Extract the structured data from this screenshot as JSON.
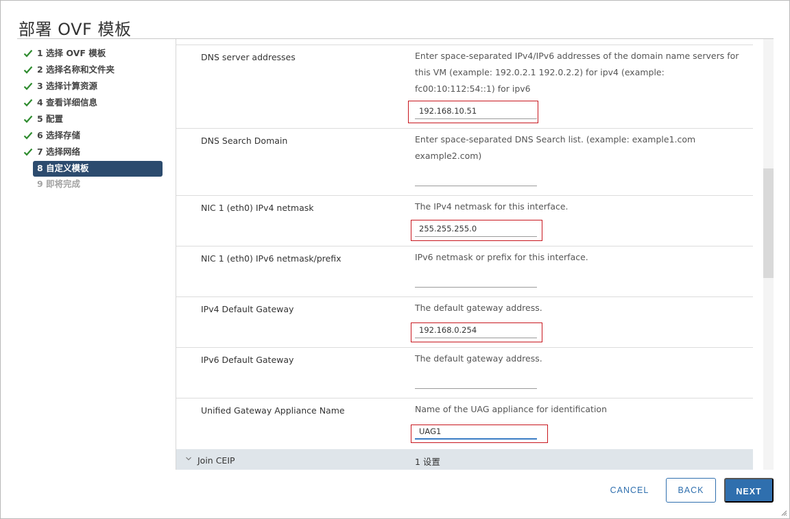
{
  "dialog": {
    "title": "部署 OVF 模板"
  },
  "steps": [
    {
      "label": "1 选择 OVF 模板",
      "status": "done"
    },
    {
      "label": "2 选择名称和文件夹",
      "status": "done"
    },
    {
      "label": "3 选择计算资源",
      "status": "done"
    },
    {
      "label": "4 查看详细信息",
      "status": "done"
    },
    {
      "label": "5 配置",
      "status": "done"
    },
    {
      "label": "6 选择存储",
      "status": "done"
    },
    {
      "label": "7 选择网络",
      "status": "done"
    },
    {
      "label": "8 自定义模板",
      "status": "active"
    },
    {
      "label": "9 即将完成",
      "status": "disabled"
    }
  ],
  "properties": [
    {
      "label": "DNS server addresses",
      "description": "Enter space-separated IPv4/IPv6 addresses of the domain name servers for this VM (example:  192.0.2.1 192.0.2.2) for ipv4 (example: fc00:10:112:54::1) for ipv6",
      "value": "192.168.10.51"
    },
    {
      "label": "DNS Search Domain",
      "description": "Enter space-separated DNS Search list. (example:  example1.com example2.com)",
      "value": ""
    },
    {
      "label": "NIC 1 (eth0) IPv4 netmask",
      "description": "The IPv4 netmask for this interface.",
      "value": "255.255.255.0"
    },
    {
      "label": "NIC 1 (eth0) IPv6 netmask/prefix",
      "description": "IPv6 netmask or prefix for this interface.",
      "value": ""
    },
    {
      "label": "IPv4 Default Gateway",
      "description": "The default gateway address.",
      "value": "192.168.0.254"
    },
    {
      "label": "IPv6 Default Gateway",
      "description": "The default gateway address.",
      "value": ""
    },
    {
      "label": "Unified Gateway Appliance Name",
      "description": "Name of the UAG appliance for identification",
      "value": "UAG1"
    }
  ],
  "group": {
    "label": "Join CEIP",
    "value": "1 设置"
  },
  "footer": {
    "cancel_label": "CANCEL",
    "back_label": "BACK",
    "next_label": "NEXT"
  },
  "colors": {
    "accent": "#2f6fae",
    "active_step": "#2c4b6e",
    "check": "#2e8b2e",
    "highlight": "#c8161d"
  }
}
